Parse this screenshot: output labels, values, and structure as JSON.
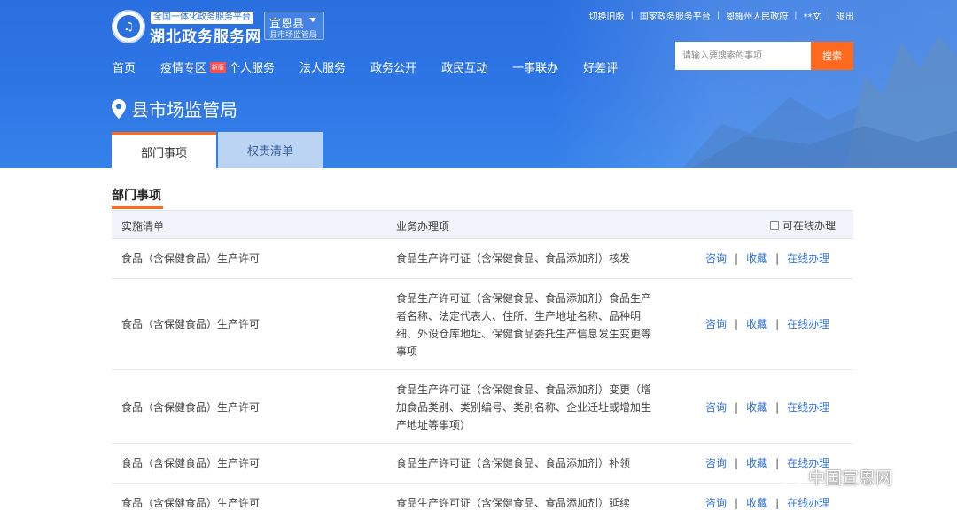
{
  "header": {
    "brand_tag": "全国一体化政务服务平台",
    "brand_name": "湖北政务服务网",
    "county": "宣恩县",
    "county_sub": "县市场监管局",
    "top_links": [
      "切换旧版",
      "国家政务服务平台",
      "恩施州人民政府",
      "**文",
      "退出"
    ],
    "search": {
      "placeholder": "请输入要搜索的事项",
      "button": "搜索"
    },
    "nav": [
      {
        "label": "首页"
      },
      {
        "label": "疫情专区",
        "badge": "新版"
      },
      {
        "label": "个人服务"
      },
      {
        "label": "法人服务"
      },
      {
        "label": "政务公开"
      },
      {
        "label": "政民互动"
      },
      {
        "label": "一事联办"
      },
      {
        "label": "好差评"
      }
    ],
    "dept_title": "县市场监管局",
    "tabs": [
      "部门事项",
      "权责清单"
    ]
  },
  "section": {
    "title": "部门事项"
  },
  "table": {
    "col1": "实施清单",
    "col2": "业务办理项",
    "online_filter": "可在线办理",
    "rows": [
      {
        "category": "食品（含保健食品）生产许可",
        "item": "食品生产许可证（含保健食品、食品添加剂）核发"
      },
      {
        "category": "食品（含保健食品）生产许可",
        "item": "食品生产许可证（含保健食品、食品添加剂）食品生产者名称、法定代表人、住所、生产地址名称、品种明细、外设仓库地址、保健食品委托生产信息发生变更等事项"
      },
      {
        "category": "食品（含保健食品）生产许可",
        "item": "食品生产许可证（含保健食品、食品添加剂）变更（增加食品类别、类别编号、类别名称、企业迁址或增加生产地址等事项）"
      },
      {
        "category": "食品（含保健食品）生产许可",
        "item": "食品生产许可证（含保健食品、食品添加剂）补领"
      },
      {
        "category": "食品（含保健食品）生产许可",
        "item": "食品生产许可证（含保健食品、食品添加剂）延续"
      }
    ],
    "actions": {
      "consult": "咨询",
      "favorite": "收藏",
      "online": "在线办理"
    }
  },
  "watermark": "中国宣恩网",
  "colors": {
    "header_blue": "#2d74e4",
    "accent_orange": "#ff6a1f",
    "link_blue": "#3273d6"
  }
}
